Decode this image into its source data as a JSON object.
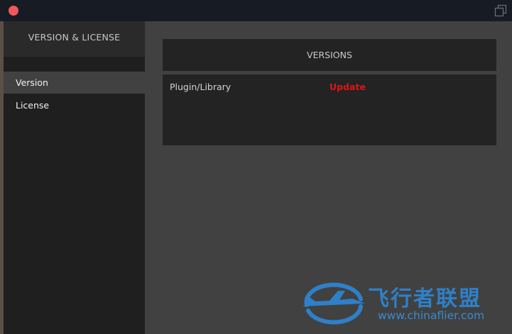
{
  "sidebar": {
    "title": "VERSION & LICENSE",
    "items": [
      {
        "label": "Version",
        "active": true
      },
      {
        "label": "License",
        "active": false
      }
    ]
  },
  "main": {
    "panel_title": "VERSIONS",
    "rows": [
      {
        "name": "Plugin/Library",
        "status": "Update"
      }
    ]
  },
  "watermark": {
    "title": "飞行者联盟",
    "url": "www.chinaflier.com"
  },
  "colors": {
    "close": "#f0595a",
    "update": "#e01414",
    "watermark": "#2e80c8"
  },
  "icons": {
    "close": "close-icon",
    "popout": "popout-window-icon"
  }
}
